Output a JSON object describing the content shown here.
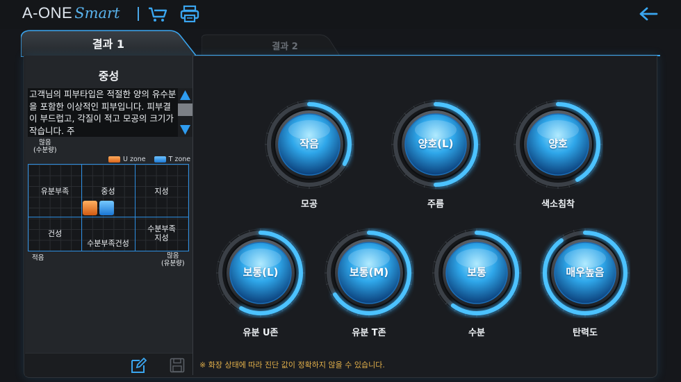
{
  "header": {
    "logo_main": "A-ONE",
    "logo_smart": "Smart",
    "icons": [
      "cart-icon",
      "printer-icon",
      "back-arrow-icon"
    ],
    "accent_color": "#3aa6f0"
  },
  "tabs": [
    {
      "label": "결과 1",
      "active": true
    },
    {
      "label": "결과 2",
      "active": false
    }
  ],
  "skin_type": {
    "title": "중성",
    "description": "고객님의 피부타입은 적절한 양의 유수분을 포함한 이상적인 피부입니다. 피부결이 부드럽고, 각질이 적고 모공의 크기가 작습니다. 주"
  },
  "matrix": {
    "y_axis_top": "많음\n(수분량)",
    "x_axis_left": "적음",
    "x_axis_right": "많음\n(유분량)",
    "legend": {
      "u_zone": "U zone",
      "t_zone": "T zone"
    },
    "cells": {
      "top_left": "유분부족",
      "top_mid": "중성",
      "top_right": "지성",
      "bottom_left": "건성",
      "bottom_mid": "수분부족건성",
      "bottom_right": "수분부족\n지성"
    },
    "colors": {
      "u_zone": "#e8782a",
      "t_zone": "#2a8ee8"
    }
  },
  "results": [
    {
      "label": "모공",
      "value": "작음",
      "level": 0.33
    },
    {
      "label": "주름",
      "value": "양호(L)",
      "level": 0.5
    },
    {
      "label": "색소침착",
      "value": "양호",
      "level": 0.42
    },
    {
      "label": "유분 U존",
      "value": "보통(L)",
      "level": 0.58
    },
    {
      "label": "유분 T존",
      "value": "보통(M)",
      "level": 0.66
    },
    {
      "label": "수분",
      "value": "보통",
      "level": 0.6
    },
    {
      "label": "탄력도",
      "value": "매우높음",
      "level": 0.9
    }
  ],
  "footer": {
    "notice": "※ 화장 상태에 따라 진단 값이 정확하지 않을 수 있습니다.",
    "icons": [
      "edit-icon",
      "save-icon"
    ]
  }
}
